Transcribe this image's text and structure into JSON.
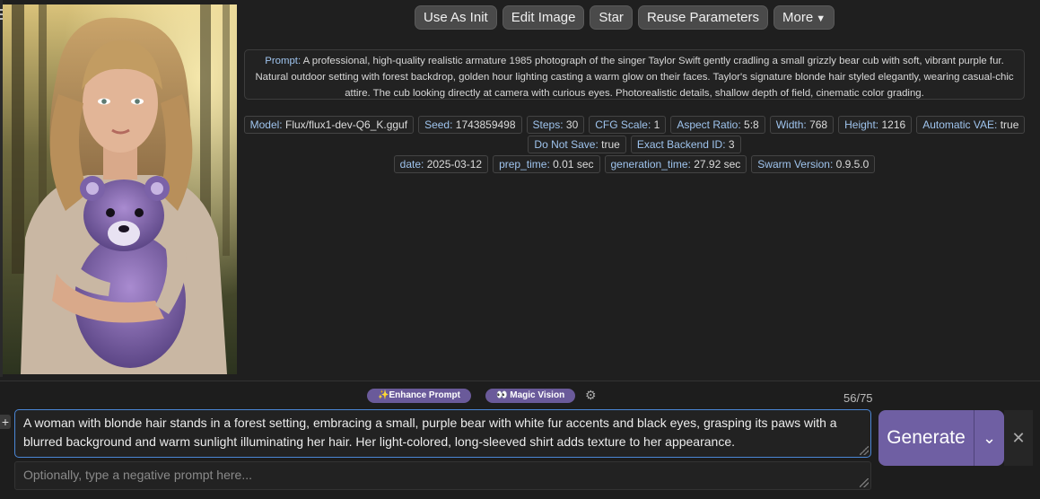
{
  "toolbar": {
    "use_as_init": "Use As Init",
    "edit_image": "Edit Image",
    "star": "Star",
    "reuse_parameters": "Reuse Parameters",
    "more": "More"
  },
  "prompt": {
    "label": "Prompt:",
    "text": "A professional, high-quality realistic armature 1985 photograph of the singer Taylor Swift gently cradling a small grizzly bear cub with soft, vibrant purple fur. Natural outdoor setting with forest backdrop, golden hour lighting casting a warm glow on their faces. Taylor's signature blonde hair styled elegantly, wearing casual-chic attire. The cub looking directly at camera with curious eyes. Photorealistic details, shallow depth of field, cinematic color grading."
  },
  "metadata": {
    "row1": [
      {
        "key": "Model:",
        "value": "Flux/flux1-dev-Q6_K.gguf"
      },
      {
        "key": "Seed:",
        "value": "1743859498"
      },
      {
        "key": "Steps:",
        "value": "30"
      },
      {
        "key": "CFG Scale:",
        "value": "1"
      },
      {
        "key": "Aspect Ratio:",
        "value": "5:8"
      },
      {
        "key": "Width:",
        "value": "768"
      },
      {
        "key": "Height:",
        "value": "1216"
      },
      {
        "key": "Automatic VAE:",
        "value": "true"
      }
    ],
    "row2": [
      {
        "key": "Do Not Save:",
        "value": "true"
      },
      {
        "key": "Exact Backend ID:",
        "value": "3"
      }
    ],
    "row3": [
      {
        "key": "date:",
        "value": "2025-03-12"
      },
      {
        "key": "prep_time:",
        "value": "0.01 sec"
      },
      {
        "key": "generation_time:",
        "value": "27.92 sec"
      },
      {
        "key": "Swarm Version:",
        "value": "0.9.5.0"
      }
    ]
  },
  "input": {
    "enhance_prompt": "Enhance Prompt",
    "magic_vision": "Magic Vision",
    "token_counter": "56/75",
    "main_prompt": "A woman with blonde hair stands in a forest setting, embracing a small, purple bear with white fur accents and black eyes, grasping its paws with a blurred background and warm sunlight illuminating her hair. Her light-colored, long-sleeved shirt adds texture to her appearance.",
    "negative_placeholder": "Optionally, type a negative prompt here...",
    "generate": "Generate"
  },
  "colors": {
    "accent_purple": "#6f5fa3",
    "focus_blue": "#4b87d6",
    "label_blue": "#9fc4ee",
    "background": "#1f1f1f"
  }
}
